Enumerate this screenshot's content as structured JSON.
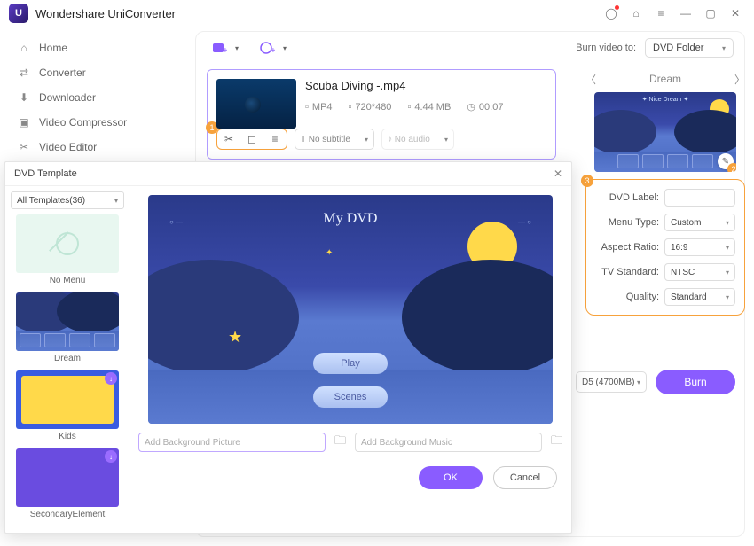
{
  "app": {
    "title": "Wondershare UniConverter"
  },
  "sidebar": {
    "items": [
      {
        "label": "Home"
      },
      {
        "label": "Converter"
      },
      {
        "label": "Downloader"
      },
      {
        "label": "Video Compressor"
      },
      {
        "label": "Video Editor"
      }
    ]
  },
  "toolbar": {
    "burn_to_label": "Burn video to:",
    "burn_to_value": "DVD Folder"
  },
  "video": {
    "title": "Scuba Diving -.mp4",
    "format": "MP4",
    "resolution": "720*480",
    "size": "4.44 MB",
    "duration": "00:07",
    "subtitle": "No subtitle",
    "audio": "No audio"
  },
  "badges": {
    "one": "1",
    "two": "2",
    "three": "3"
  },
  "preview": {
    "title": "Dream",
    "scene_label": "✦  Nice Dream  ✦"
  },
  "settings": {
    "dvd_label_label": "DVD Label:",
    "dvd_label_value": "",
    "menu_type_label": "Menu Type:",
    "menu_type_value": "Custom",
    "aspect_label": "Aspect Ratio:",
    "aspect_value": "16:9",
    "tv_label": "TV Standard:",
    "tv_value": "NTSC",
    "quality_label": "Quality:",
    "quality_value": "Standard"
  },
  "burn": {
    "media": "D5 (4700MB)",
    "button": "Burn"
  },
  "template": {
    "title": "DVD Template",
    "filter": "All Templates(36)",
    "items": [
      {
        "name": "No Menu"
      },
      {
        "name": "Dream"
      },
      {
        "name": "Kids"
      },
      {
        "name": "SecondaryElement"
      }
    ],
    "big_title": "My DVD",
    "play": "Play",
    "scenes": "Scenes",
    "bg_picture_placeholder": "Add Background Picture",
    "bg_music_placeholder": "Add Background Music",
    "ok": "OK",
    "cancel": "Cancel"
  }
}
